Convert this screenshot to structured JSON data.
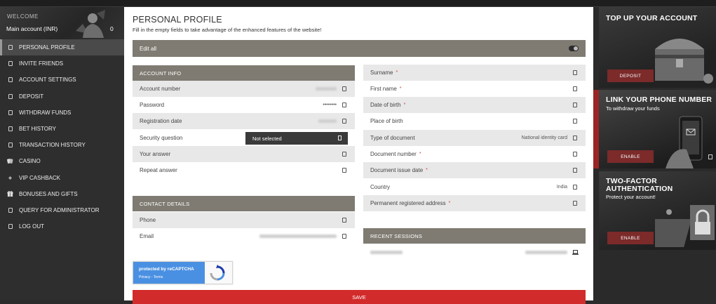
{
  "sidebar": {
    "welcome": "WELCOME",
    "account": "Main account (INR)",
    "balance": "0",
    "items": [
      {
        "label": "PERSONAL PROFILE",
        "icon": "square-icon",
        "active": true
      },
      {
        "label": "INVITE FRIENDS",
        "icon": "square-icon"
      },
      {
        "label": "ACCOUNT SETTINGS",
        "icon": "square-icon"
      },
      {
        "label": "DEPOSIT",
        "icon": "square-icon"
      },
      {
        "label": "WITHDRAW FUNDS",
        "icon": "square-icon"
      },
      {
        "label": "BET HISTORY",
        "icon": "square-icon"
      },
      {
        "label": "TRANSACTION HISTORY",
        "icon": "square-icon"
      },
      {
        "label": "CASINO",
        "icon": "cards-icon"
      },
      {
        "label": "VIP CASHBACK",
        "icon": "diamond-icon"
      },
      {
        "label": "BONUSES AND GIFTS",
        "icon": "gift-icon"
      },
      {
        "label": "QUERY FOR ADMINISTRATOR",
        "icon": "square-icon"
      },
      {
        "label": "LOG OUT",
        "icon": "square-icon"
      }
    ]
  },
  "profile": {
    "title": "PERSONAL PROFILE",
    "subtitle": "Fill in the empty fields to take advantage of the enhanced features of the website!",
    "edit_all": "Edit all",
    "account_info": {
      "heading": "ACCOUNT INFO",
      "account_number": "Account number",
      "password": "Password",
      "password_value": "••••••••",
      "registration_date": "Registration date",
      "security_question": "Security question",
      "security_question_value": "Not selected",
      "your_answer": "Your answer",
      "repeat_answer": "Repeat answer"
    },
    "contact_details": {
      "heading": "CONTACT DETAILS",
      "phone": "Phone",
      "email": "Email"
    },
    "personal": {
      "surname": "Surname",
      "first_name": "First name",
      "date_of_birth": "Date of birth",
      "place_of_birth": "Place of birth",
      "type_of_document": "Type of document",
      "type_of_document_value": "National identity card",
      "document_number": "Document number",
      "document_issue_date": "Document issue date",
      "country": "Country",
      "country_value": "India",
      "permanent_address": "Permanent registered address",
      "required_mark": "*"
    },
    "recent_sessions": {
      "heading": "RECENT SESSIONS"
    },
    "recaptcha": {
      "line1": "protected by reCAPTCHA",
      "line2": "Privacy - Terms"
    },
    "save": "SAVE"
  },
  "promos": {
    "topup": {
      "title": "TOP UP YOUR ACCOUNT",
      "button": "DEPOSIT"
    },
    "phone": {
      "title": "LINK YOUR PHONE NUMBER",
      "subtitle": "To withdraw your funds",
      "button": "ENABLE"
    },
    "twofa": {
      "title_line1": "TWO-FACTOR",
      "title_line2": "AUTHENTICATION",
      "subtitle": "Protect your account!",
      "button": "ENABLE"
    }
  },
  "colors": {
    "section_header": "#7f7b72",
    "save_button": "#d22b2b",
    "promo_button": "#7c2a2a",
    "recaptcha_blue": "#4a90e2"
  }
}
